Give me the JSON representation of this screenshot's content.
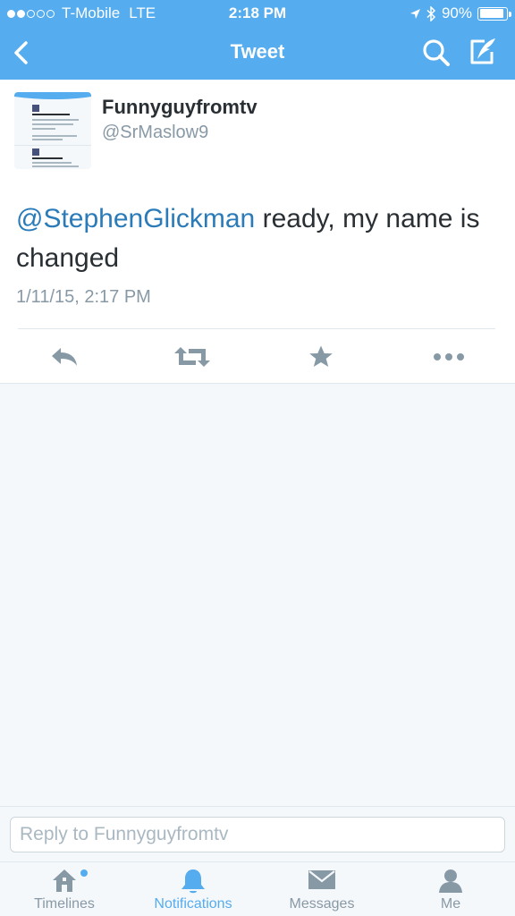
{
  "status_bar": {
    "carrier": "T-Mobile",
    "network": "LTE",
    "time": "2:18 PM",
    "battery": "90%",
    "battery_level": 0.9,
    "signal_bars_filled": 2,
    "signal_bars_total": 5
  },
  "nav": {
    "title": "Tweet",
    "back_icon": "chevron-left-icon",
    "search_icon": "search-icon",
    "compose_icon": "compose-icon"
  },
  "tweet": {
    "author_name": "Funnyguyfromtv",
    "author_handle": "@SrMaslow9",
    "text_mention": "@StephenGlickman",
    "text_body": " ready, my name is changed",
    "timestamp": "1/11/15, 2:17 PM"
  },
  "actions": [
    "reply-icon",
    "retweet-icon",
    "favorite-icon",
    "more-icon"
  ],
  "reply": {
    "placeholder": "Reply to Funnyguyfromtv",
    "value": ""
  },
  "tabs": [
    {
      "label": "Timelines",
      "icon": "home-icon",
      "active": false,
      "has_badge": true
    },
    {
      "label": "Notifications",
      "icon": "bell-icon",
      "active": true,
      "has_badge": false
    },
    {
      "label": "Messages",
      "icon": "envelope-icon",
      "active": false,
      "has_badge": false
    },
    {
      "label": "Me",
      "icon": "person-icon",
      "active": false,
      "has_badge": false
    }
  ],
  "colors": {
    "brand": "#55acee",
    "link": "#2b7bb9",
    "text": "#292f33",
    "muted": "#8899a6",
    "icon": "#8899a6",
    "background": "#f5f8fa"
  }
}
